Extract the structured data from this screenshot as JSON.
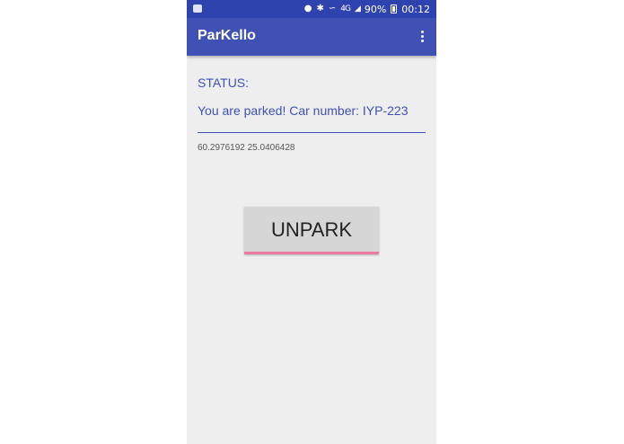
{
  "status_bar": {
    "left_icon": "notification-icon",
    "icons": [
      "location-pin-icon",
      "bluetooth-icon",
      "mute-icon",
      "4g-icon",
      "signal-icon"
    ],
    "network": "4G",
    "battery": "90%",
    "time": "00:12"
  },
  "app_bar": {
    "title": "ParKello",
    "menu_icon": "overflow-menu-icon"
  },
  "main": {
    "status_label": "STATUS:",
    "parked_message": "You are parked! Car number: IYP-223",
    "coordinates": "60.2976192 25.0406428",
    "unpark_button_label": "UNPARK"
  },
  "colors": {
    "primary": "#3f51b5",
    "status_bar": "#2e43ae",
    "background": "#eeeeee",
    "button": "#d6d6d6",
    "accent": "#ec7aa0"
  }
}
